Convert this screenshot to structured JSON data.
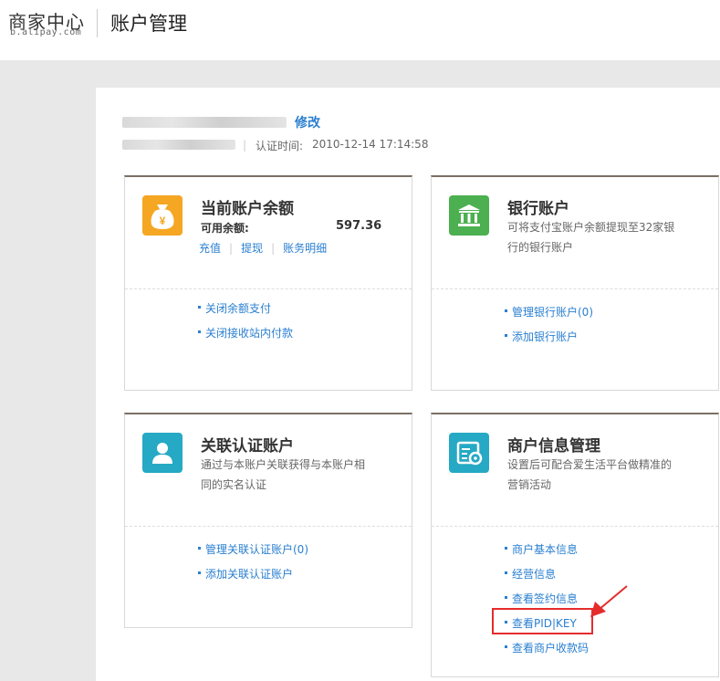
{
  "header": {
    "logo_main": "商家中心",
    "logo_sub": "b.alipay.com",
    "title": "账户管理"
  },
  "account": {
    "edit_label": "修改",
    "cert_label": "认证时间:",
    "cert_time": "2010-12-14 17:14:58"
  },
  "cards": {
    "balance": {
      "title": "当前账户余额",
      "available_label": "可用余额:",
      "available_amount": "597.36",
      "actions": [
        "充值",
        "提现",
        "账务明细"
      ],
      "links": [
        "关闭余额支付",
        "关闭接收站内付款"
      ]
    },
    "bank": {
      "title": "银行账户",
      "desc": "可将支付宝账户余额提现至32家银行的银行账户",
      "links": [
        "管理银行账户(0)",
        "添加银行账户"
      ]
    },
    "linked": {
      "title": "关联认证账户",
      "desc": "通过与本账户关联获得与本账户相同的实名认证",
      "links": [
        "管理关联认证账户(0)",
        "添加关联认证账户"
      ]
    },
    "merchant": {
      "title": "商户信息管理",
      "desc": "设置后可配合爱生活平台做精准的营销活动",
      "links": [
        "商户基本信息",
        "经营信息",
        "查看签约信息",
        "查看PID|KEY",
        "查看商户收款码"
      ]
    }
  },
  "colors": {
    "link": "#2a7fd0",
    "card_top_border": "#7a6f63",
    "balance_icon": "#f5a623",
    "bank_icon": "#4caf50",
    "linked_icon": "#26a9c4",
    "merchant_icon": "#26a9c4",
    "highlight": "#e52c2c"
  },
  "icons": {
    "balance": "money-bag-icon",
    "bank": "bank-building-icon",
    "linked": "user-icon",
    "merchant": "settings-form-icon"
  }
}
